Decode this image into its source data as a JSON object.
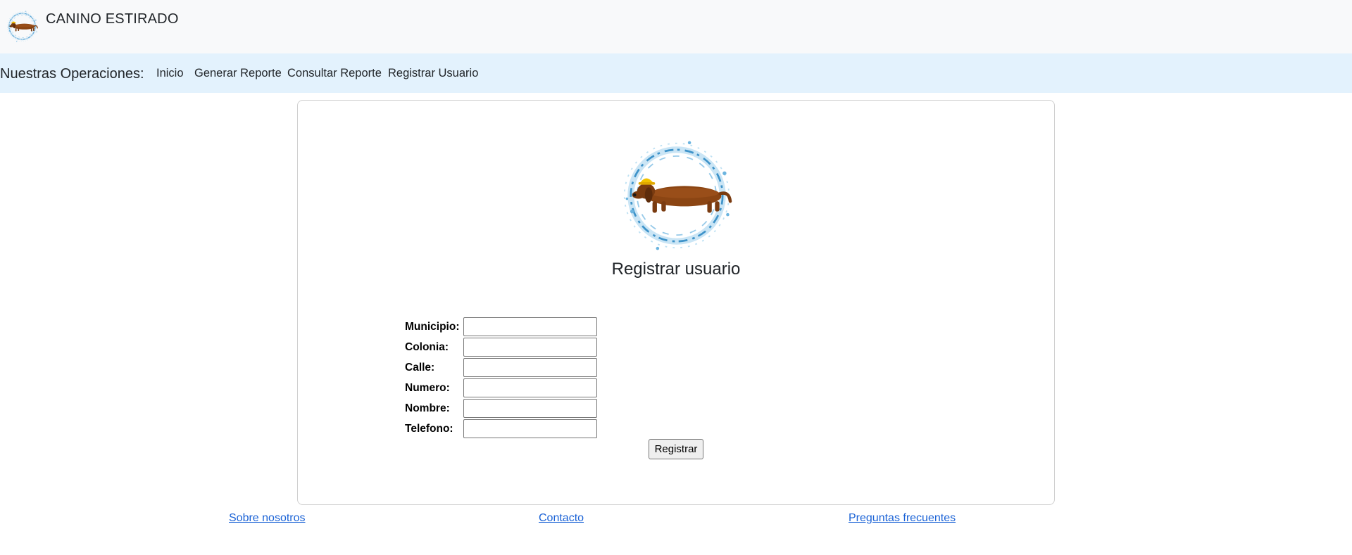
{
  "header": {
    "brand_title": "CANINO ESTIRADO",
    "logo_icon": "dachshund-water-ring-logo"
  },
  "nav": {
    "label": "Nuestras Operaciones:",
    "links": [
      {
        "label": "Inicio"
      },
      {
        "label": "Generar Reporte"
      },
      {
        "label": "Consultar Reporte"
      },
      {
        "label": "Registrar Usuario"
      }
    ]
  },
  "card": {
    "logo_icon": "dachshund-water-ring-logo",
    "title": "Registrar usuario",
    "fields": [
      {
        "label": "Municipio:",
        "value": ""
      },
      {
        "label": "Colonia:",
        "value": ""
      },
      {
        "label": "Calle:",
        "value": ""
      },
      {
        "label": "Numero:",
        "value": ""
      },
      {
        "label": "Nombre:",
        "value": ""
      },
      {
        "label": "Telefono:",
        "value": ""
      }
    ],
    "submit_label": "Registrar"
  },
  "footer": {
    "links": [
      {
        "label": "Sobre nosotros"
      },
      {
        "label": "Contacto"
      },
      {
        "label": "Preguntas frecuentes"
      }
    ]
  },
  "colors": {
    "header_bg": "#f8f9fa",
    "nav_bg": "#e3f2fd",
    "link": "#1a62d6",
    "dog": "#8b4513",
    "water": "#5aa9d6"
  }
}
